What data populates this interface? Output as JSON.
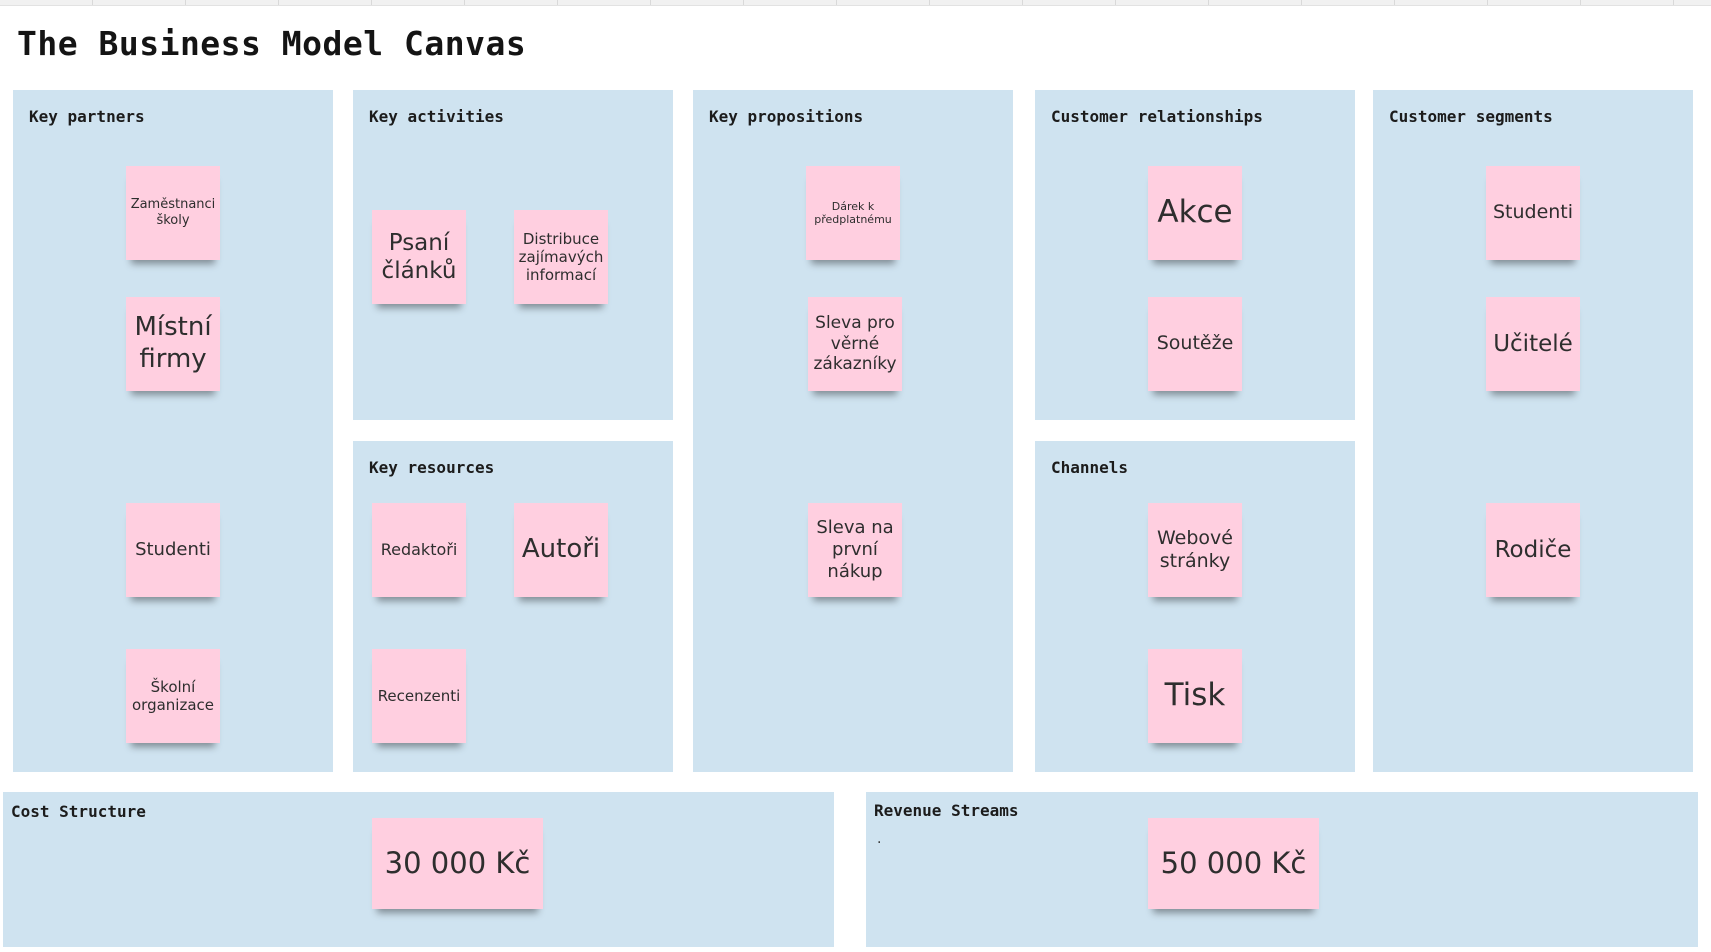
{
  "title": "The Business Model Canvas",
  "colors": {
    "panel": "#cfe3f0",
    "sticky_note": "#ffcfe0"
  },
  "panels": {
    "key_partners": {
      "label": "Key partners",
      "notes": [
        "Zaměstnanci školy",
        "Místní firmy",
        "Studenti",
        "Školní organizace"
      ]
    },
    "key_activities": {
      "label": "Key activities",
      "notes": [
        "Psaní článků",
        "Distribuce zajímavých informací"
      ]
    },
    "key_resources": {
      "label": "Key resources",
      "notes": [
        "Redaktoři",
        "Autoři",
        "Recenzenti"
      ]
    },
    "key_propositions": {
      "label": "Key propositions",
      "notes": [
        "Dárek k předplatnému",
        "Sleva pro věrné zákazníky",
        "Sleva na první nákup"
      ]
    },
    "customer_relationships": {
      "label": "Customer relationships",
      "notes": [
        "Akce",
        "Soutěže"
      ]
    },
    "channels": {
      "label": "Channels",
      "notes": [
        "Webové stránky",
        "Tisk"
      ]
    },
    "customer_segments": {
      "label": "Customer segments",
      "notes": [
        "Studenti",
        "Učitelé",
        "Rodiče"
      ]
    },
    "cost_structure": {
      "label": "Cost Structure",
      "notes": [
        "30 000 Kč"
      ]
    },
    "revenue_streams": {
      "label": "Revenue Streams",
      "marker": ".",
      "notes": [
        "50 000 Kč"
      ]
    }
  }
}
